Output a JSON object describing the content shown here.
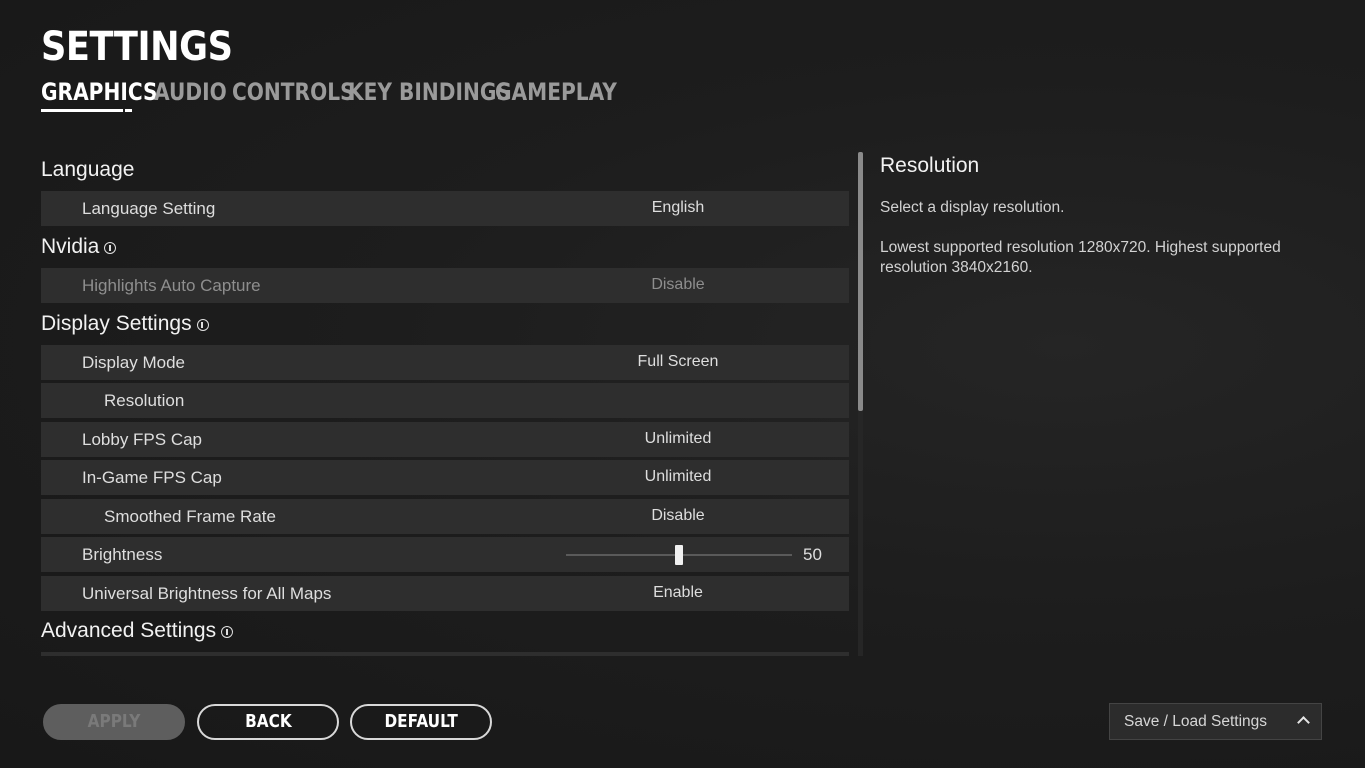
{
  "page": {
    "title": "SETTINGS"
  },
  "tabs": [
    {
      "label": "GRAPHICS",
      "active": true
    },
    {
      "label": "AUDIO",
      "active": false
    },
    {
      "label": "CONTROLS",
      "active": false
    },
    {
      "label": "KEY BINDINGS",
      "active": false
    },
    {
      "label": "GAMEPLAY",
      "active": false
    }
  ],
  "sections": {
    "language": {
      "label": "Language"
    },
    "nvidia": {
      "label": "Nvidia"
    },
    "display": {
      "label": "Display Settings"
    },
    "advanced": {
      "label": "Advanced Settings"
    }
  },
  "rows": {
    "language_setting": {
      "label": "Language Setting",
      "value": "English"
    },
    "highlights": {
      "label": "Highlights Auto Capture",
      "value": "Disable",
      "disabled": true
    },
    "display_mode": {
      "label": "Display Mode",
      "value": "Full Screen"
    },
    "resolution": {
      "label": "Resolution",
      "value": ""
    },
    "lobby_fps": {
      "label": "Lobby FPS Cap",
      "value": "Unlimited"
    },
    "ingame_fps": {
      "label": "In-Game FPS Cap",
      "value": "Unlimited"
    },
    "smoothed": {
      "label": "Smoothed Frame Rate",
      "value": "Disable"
    },
    "brightness": {
      "label": "Brightness",
      "value": "50",
      "slider_fraction": 0.5
    },
    "universal_brightness": {
      "label": "Universal Brightness for All Maps",
      "value": "Enable"
    }
  },
  "description": {
    "title": "Resolution",
    "line1": "Select a display resolution.",
    "line2": "Lowest supported resolution 1280x720. Highest supported resolution 3840x2160."
  },
  "buttons": {
    "apply": "APPLY",
    "back": "BACK",
    "default": "DEFAULT",
    "save_load": "Save / Load Settings"
  },
  "icons": {
    "info": "info-icon",
    "chevron": "chevron-up-icon"
  }
}
